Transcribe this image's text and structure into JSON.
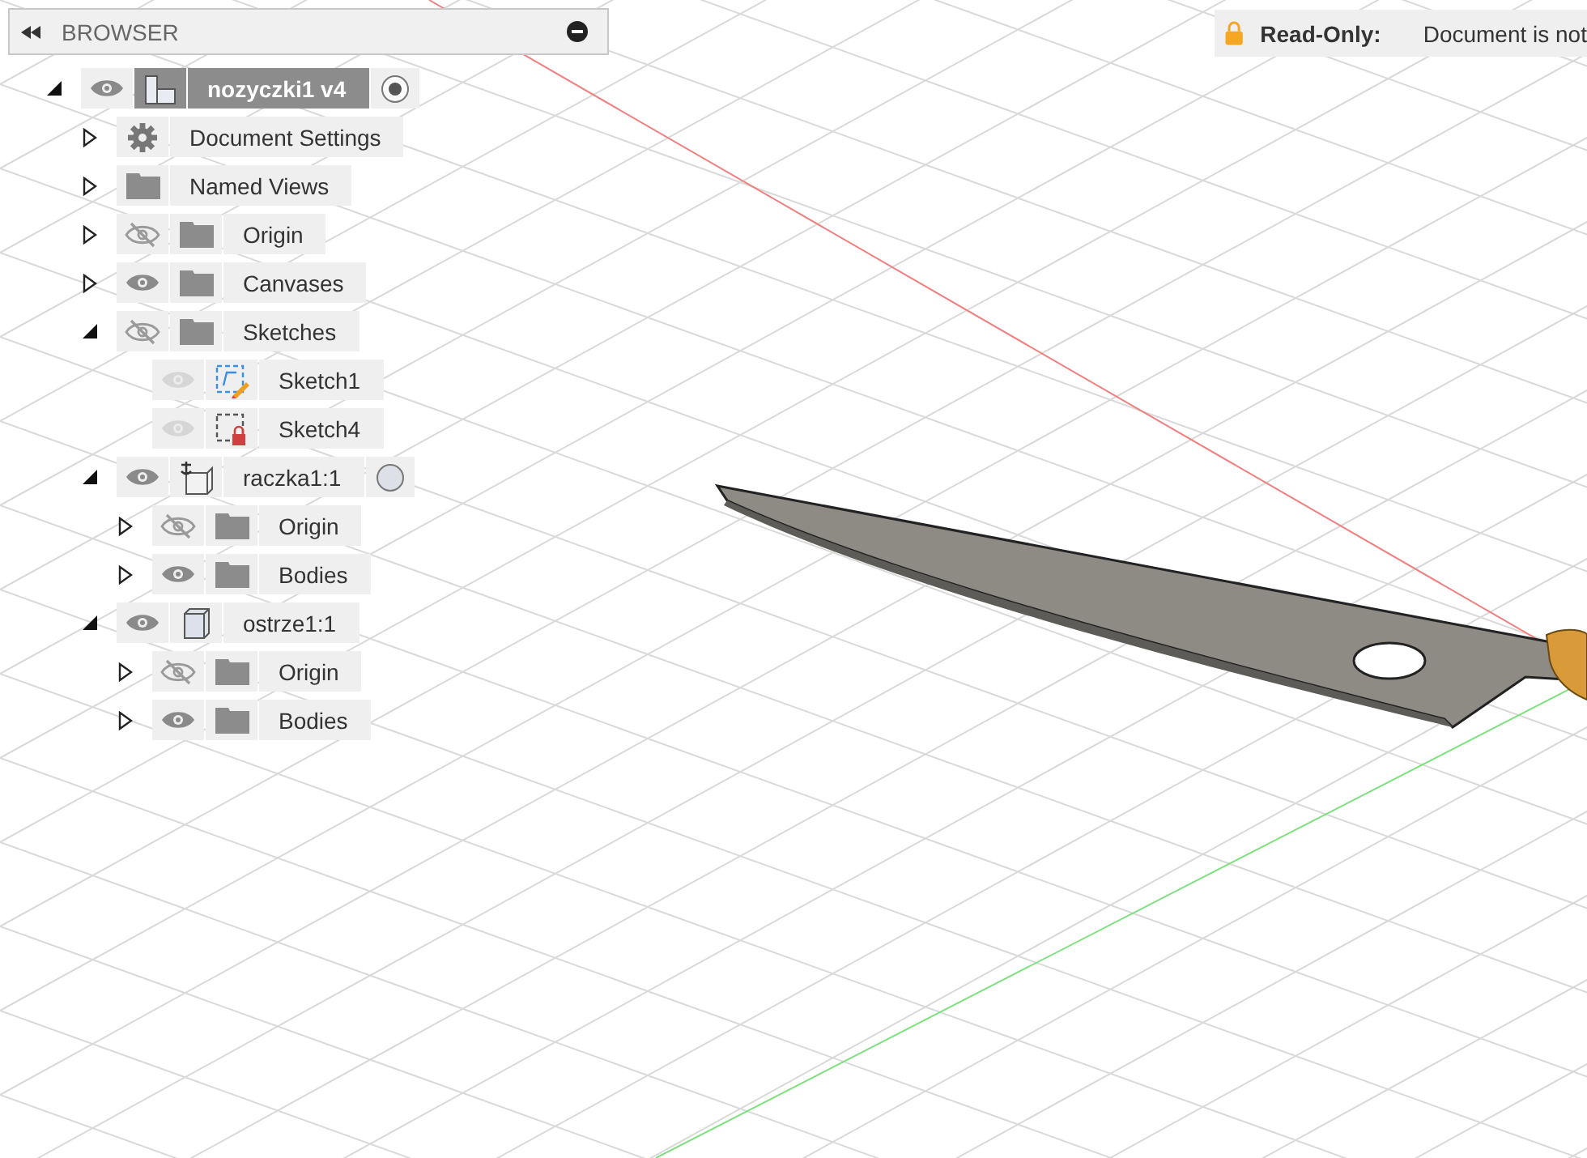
{
  "browser": {
    "title": "BROWSER",
    "tree": [
      {
        "label": "nozyczki1 v4",
        "kind": "document",
        "visible": true,
        "disabled": false,
        "selected": true,
        "expanded": true,
        "active": true,
        "children": [
          {
            "label": "Document Settings",
            "kind": "settings",
            "selected": false,
            "expanded": false
          },
          {
            "label": "Named Views",
            "kind": "folder",
            "selected": false,
            "expanded": false
          },
          {
            "label": "Origin",
            "kind": "folder",
            "visible": false,
            "disabled": false,
            "selected": false,
            "expanded": false
          },
          {
            "label": "Canvases",
            "kind": "folder",
            "visible": true,
            "disabled": false,
            "selected": false,
            "expanded": false
          },
          {
            "label": "Sketches",
            "kind": "folder",
            "visible": false,
            "disabled": false,
            "selected": false,
            "expanded": true,
            "children": [
              {
                "label": "Sketch1",
                "kind": "sketch",
                "visible": true,
                "disabled": true,
                "selected": false
              },
              {
                "label": "Sketch4",
                "kind": "sketch-locked",
                "visible": true,
                "disabled": true,
                "selected": false
              }
            ]
          },
          {
            "label": "raczka1:1",
            "kind": "component-grounded",
            "visible": true,
            "disabled": false,
            "selected": false,
            "expanded": true,
            "active": false,
            "children": [
              {
                "label": "Origin",
                "kind": "folder",
                "visible": false,
                "disabled": false,
                "selected": false,
                "expanded": false
              },
              {
                "label": "Bodies",
                "kind": "folder",
                "visible": true,
                "disabled": false,
                "selected": false,
                "expanded": false
              }
            ]
          },
          {
            "label": "ostrze1:1",
            "kind": "component",
            "visible": true,
            "disabled": false,
            "selected": false,
            "expanded": true,
            "children": [
              {
                "label": "Origin",
                "kind": "folder",
                "visible": false,
                "disabled": false,
                "selected": false,
                "expanded": false
              },
              {
                "label": "Bodies",
                "kind": "folder",
                "visible": true,
                "disabled": false,
                "selected": false,
                "expanded": false
              }
            ]
          }
        ]
      }
    ]
  },
  "banner": {
    "label": "Read-Only:",
    "message": "Document is not"
  }
}
